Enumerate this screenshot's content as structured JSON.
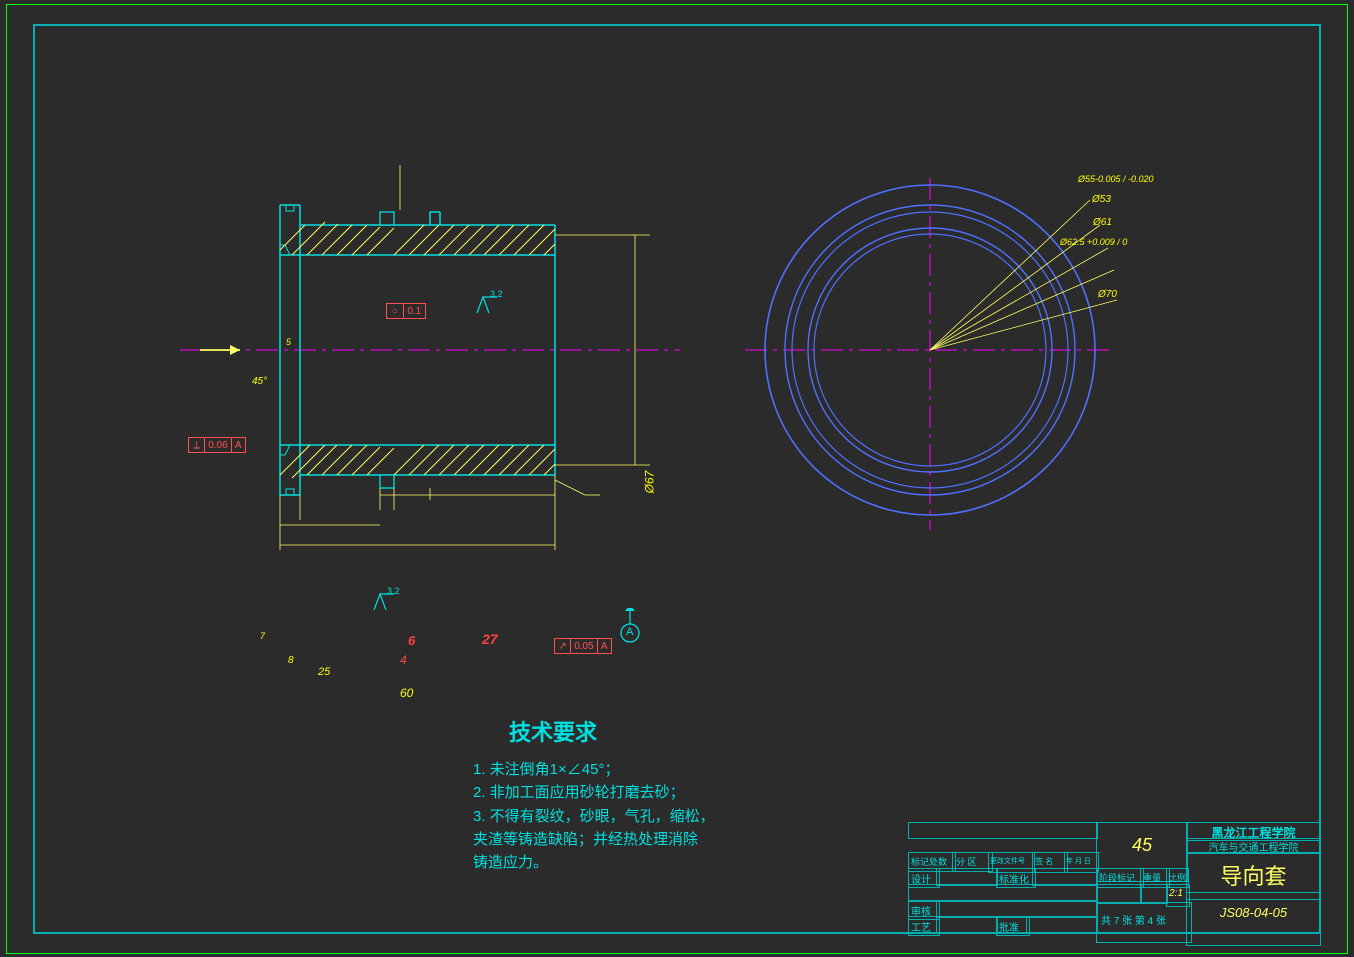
{
  "title_block": {
    "institute": "黑龙江工程学院",
    "department": "汽车与交通工程学院",
    "part_name": "导向套",
    "material": "45",
    "drawing_no": "JS08-04-05",
    "scale_label": "比例",
    "scale_value": "2:1",
    "mass_label": "重量",
    "stage_label": "阶段标记",
    "sheet_info": "共 7 张    第 4 张",
    "row_labels": {
      "mark_count": "标记处数",
      "zone": "分 区",
      "change_doc": "更改文件号",
      "sign": "签 名",
      "date": "年 月 日",
      "design": "设计",
      "std": "标准化",
      "check": "审核",
      "process": "工艺",
      "approve": "批准"
    }
  },
  "notes": {
    "heading": "技术要求",
    "lines": [
      "1. 未注倒角1×∠45°；",
      "2. 非加工面应用砂轮打磨去砂；",
      "3. 不得有裂纹，砂眼，气孔，缩松，",
      "夹渣等铸造缺陷；并经热处理消除",
      "铸造应力。"
    ]
  },
  "gdt": {
    "perp": {
      "sym": "⟂",
      "tol": "0.06",
      "datum": "A"
    },
    "cyl": {
      "sym": "○",
      "tol": "0.1"
    },
    "runout": {
      "sym": "↗",
      "tol": "0.05",
      "datum": "A"
    }
  },
  "datum": "A",
  "surface_finish": [
    "3.2",
    "3.2"
  ],
  "dims_section": {
    "chamfer": "45°",
    "d5": "5",
    "d7": "7",
    "d6": "6",
    "d8": "8",
    "d4": "4",
    "d25": "25",
    "d27": "27",
    "d60": "60",
    "dia67": "Ø67"
  },
  "dims_end": {
    "a": "Ø55-0.005 / -0.020",
    "b": "Ø53",
    "c": "Ø61",
    "d": "Ø62.5 +0.009 / 0",
    "e": "Ø70"
  }
}
